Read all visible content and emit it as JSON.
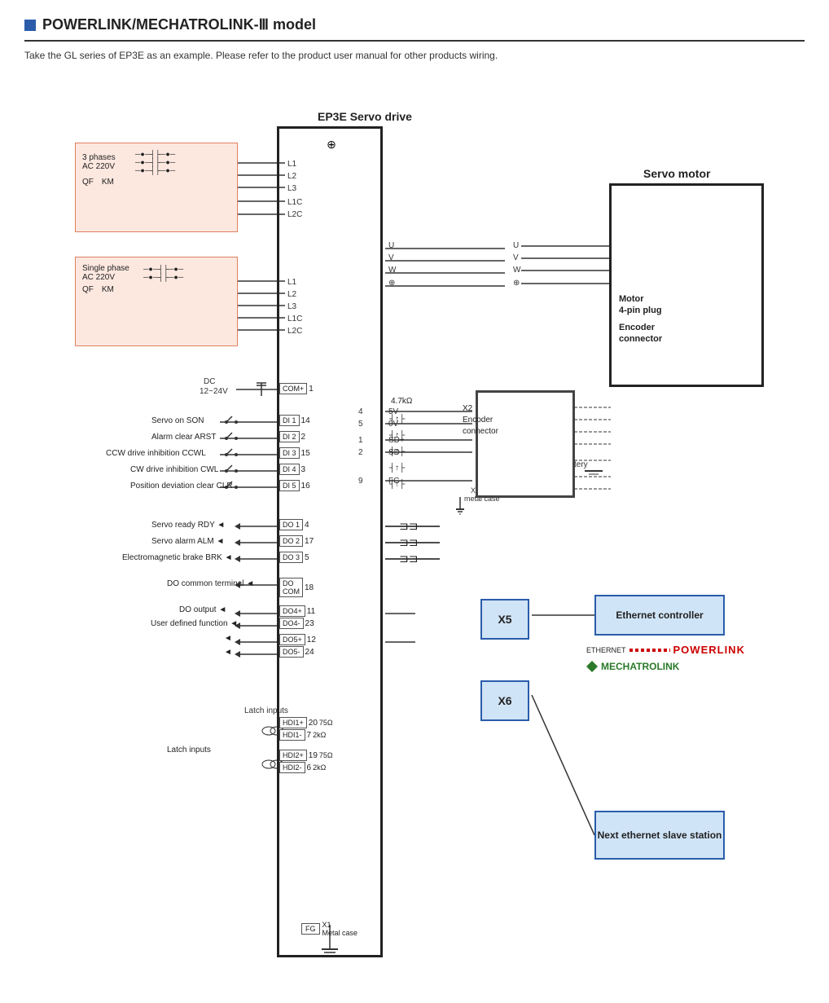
{
  "title": "POWERLINK/MECHATROLINK-Ⅲ model",
  "subtitle": "Take the GL series of EP3E as an example. Please refer to the product user manual for other products wiring.",
  "servo_drive_label": "EP3E Servo drive",
  "servo_motor_label": "Servo motor",
  "motor_connector_label": "Motor\n4-pin plug",
  "encoder_connector_label": "Encoder\nconnector",
  "x2_label": "X2\nEncoder\nconnector",
  "x5_label": "X5",
  "x6_label": "X6",
  "ethernet_controller_label": "Ethernet controller",
  "next_slave_label": "Next ethernet\nslave station",
  "powerlink_label": "POWERLINK",
  "mechatrolink_label": "MECHATROLINK",
  "power_3phase": {
    "label": "3 phases\nAC 220V",
    "qf": "QF",
    "km": "KM",
    "lines": [
      "L1",
      "L2",
      "L3",
      "L1C",
      "L2C"
    ]
  },
  "power_1phase": {
    "label": "Single phase\nAC 220V",
    "qf": "QF",
    "km": "KM",
    "lines": [
      "L1",
      "L2",
      "L3",
      "L1C",
      "L2C"
    ]
  },
  "di_connectors": [
    {
      "name": "COM+",
      "pin": "1"
    },
    {
      "name": "DI 1",
      "pin": "14",
      "label": "Servo on SON"
    },
    {
      "name": "DI 2",
      "pin": "2",
      "label": "Alarm clear ARST"
    },
    {
      "name": "DI 3",
      "pin": "15",
      "label": "CCW drive inhibition CCWL"
    },
    {
      "name": "DI 4",
      "pin": "3",
      "label": "CW drive inhibition CWL"
    },
    {
      "name": "DI 5",
      "pin": "16",
      "label": "Position deviation clear CLR"
    }
  ],
  "do_connectors": [
    {
      "name": "DO 1",
      "pin": "4",
      "label": "Servo ready RDY"
    },
    {
      "name": "DO 2",
      "pin": "17",
      "label": "Servo alarm ALM"
    },
    {
      "name": "DO 3",
      "pin": "5",
      "label": "Electromagnetic brake BRK"
    },
    {
      "name": "DO COM",
      "pin": "18",
      "label": "DO common terminal"
    }
  ],
  "do_diff_connectors": [
    {
      "name": "DO4+",
      "pin": "11",
      "label": "DO output"
    },
    {
      "name": "DO4-",
      "pin": "23",
      "label": "User defined function"
    },
    {
      "name": "DO5+",
      "pin": "12",
      "label": ""
    },
    {
      "name": "DO5-",
      "pin": "24",
      "label": ""
    }
  ],
  "latch_connectors": [
    {
      "name": "HDI1+",
      "pin": "20",
      "ohm": "75Ω"
    },
    {
      "name": "HDI1-",
      "pin": "7",
      "ohm": "2kΩ"
    },
    {
      "name": "HDI2+",
      "pin": "19",
      "ohm": "75Ω"
    },
    {
      "name": "HDI2-",
      "pin": "6",
      "ohm": "2kΩ"
    }
  ],
  "encoder_pins": [
    {
      "pin": "4",
      "label": "5V"
    },
    {
      "pin": "5",
      "label": "0V"
    },
    {
      "pin": "1",
      "label": "SD+"
    },
    {
      "pin": "2",
      "label": "SD-"
    },
    {
      "pin": "9",
      "label": "FG"
    }
  ],
  "motor_pins": [
    "U",
    "V",
    "W",
    "⊕"
  ],
  "fg_label": "FG",
  "x1_label": "X1\nMetal case",
  "dc_label": "DC\n12~24V",
  "resistor_4k7": "4.7kΩ",
  "battery_label": "Battery",
  "latch_label": "Latch inputs",
  "fg_bottom_label": "FG"
}
